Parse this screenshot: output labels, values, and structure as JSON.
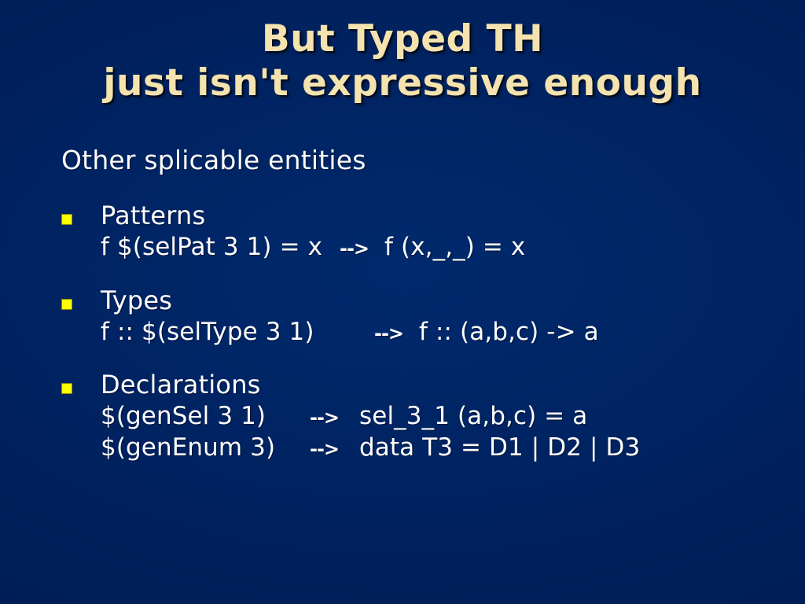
{
  "slide": {
    "background_color": "#00205c",
    "title": {
      "line1": "But Typed TH",
      "line2": "just isn't expressive enough",
      "color": "#f4e3ae"
    },
    "lead": "Other splicable entities",
    "bullet_color": "#ffff00",
    "text_color": "#ffffff",
    "bullets": [
      {
        "heading": "Patterns",
        "lines": [
          {
            "lhs": "f $(selPat 3 1) = x",
            "arrow": "-->",
            "rhs": "f (x,_,_) = x"
          }
        ]
      },
      {
        "heading": "Types",
        "lines": [
          {
            "lhs": "f :: $(selType 3 1)",
            "arrow": "-->",
            "rhs": "f :: (a,b,c) -> a"
          }
        ]
      },
      {
        "heading": "Declarations",
        "lines": [
          {
            "lhs": "$(genSel 3 1)",
            "arrow": "-->",
            "rhs": "sel_3_1 (a,b,c) = a"
          },
          {
            "lhs": "$(genEnum 3)",
            "arrow": "-->",
            "rhs": "data T3 = D1 | D2 | D3"
          }
        ]
      }
    ]
  }
}
